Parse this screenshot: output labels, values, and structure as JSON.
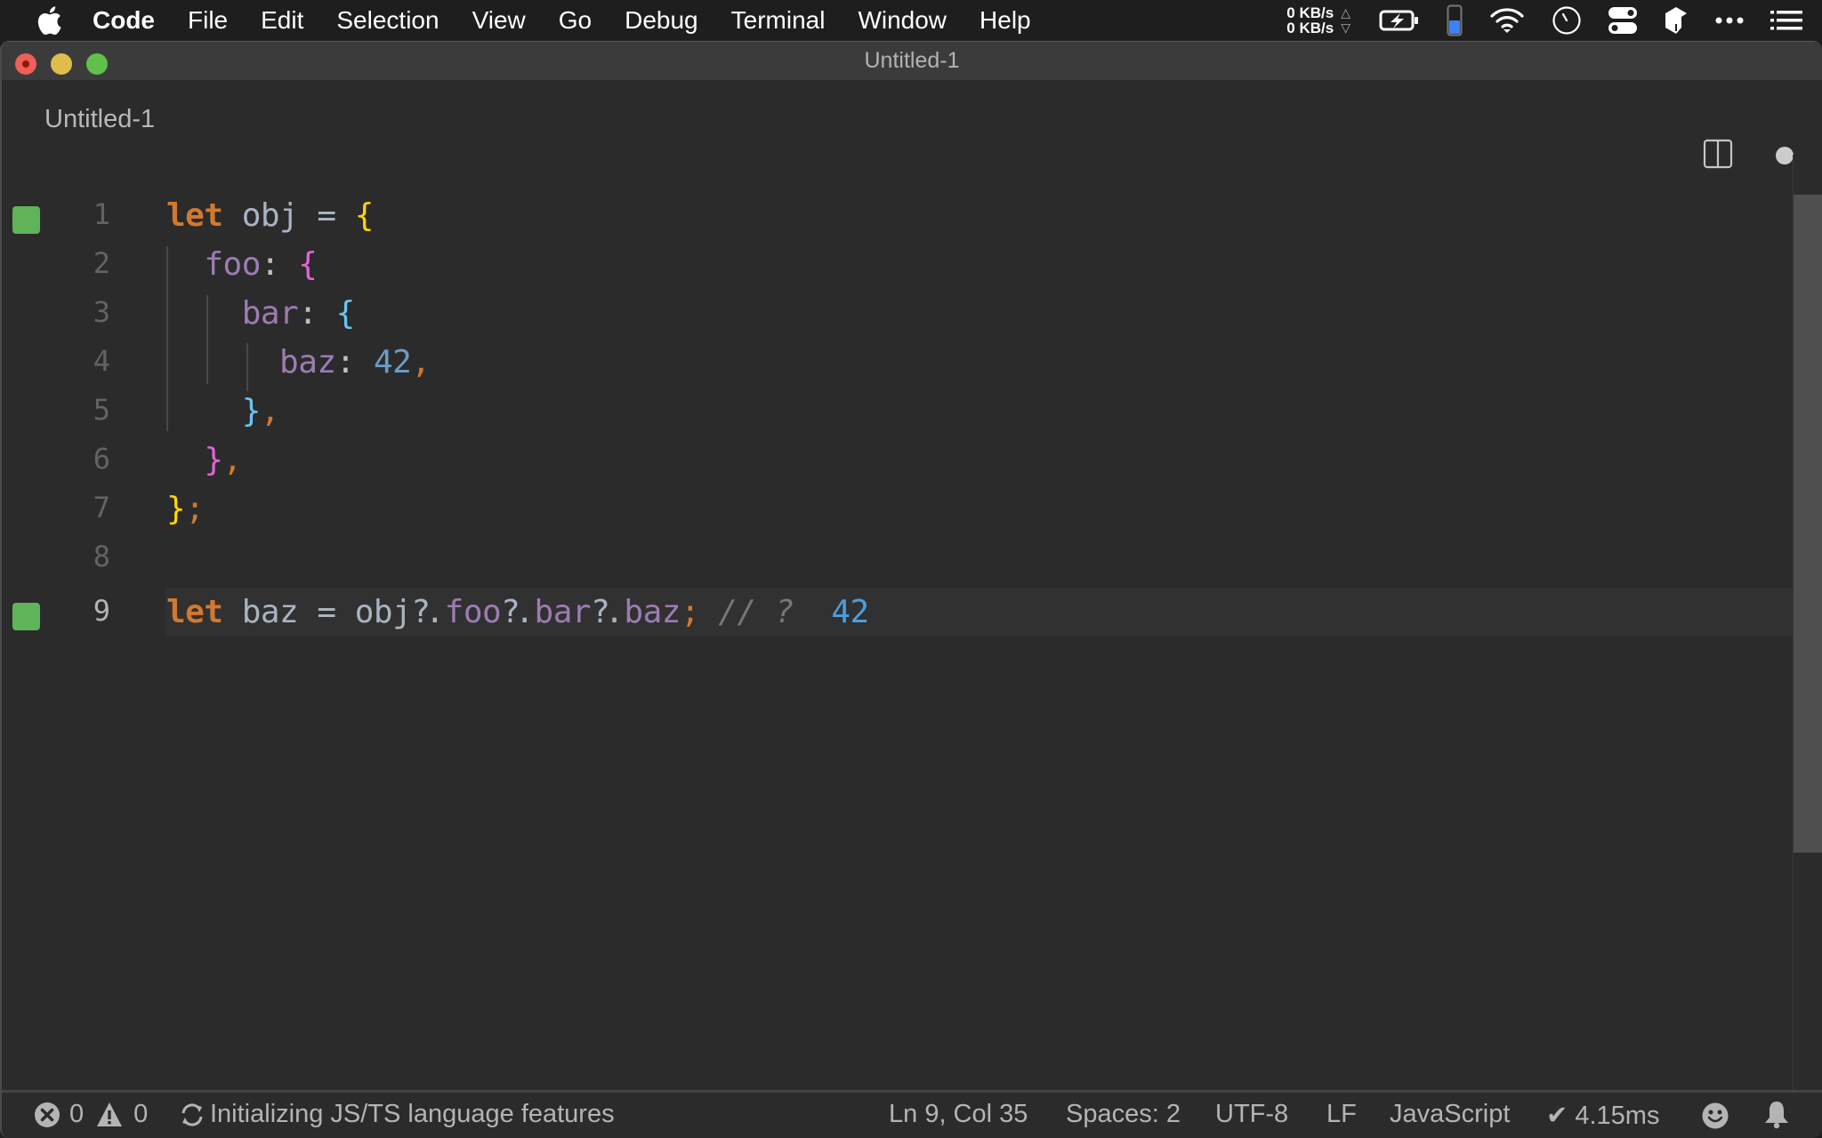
{
  "menubar": {
    "app_name": "Code",
    "items": [
      "File",
      "Edit",
      "Selection",
      "View",
      "Go",
      "Debug",
      "Terminal",
      "Window",
      "Help"
    ],
    "network": {
      "up": "0 KB/s",
      "down": "0 KB/s",
      "up_arrow": "△",
      "down_arrow": "▽"
    },
    "tray_icons": [
      "battery-charging-icon",
      "battery-level-icon",
      "wifi-icon",
      "clock-icon",
      "control-toggles-icon",
      "app-icon",
      "more-icon",
      "list-icon"
    ],
    "battery_level": 0.5
  },
  "window": {
    "title": "Untitled-1"
  },
  "tab": {
    "label": "Untitled-1",
    "dirty": true
  },
  "editor": {
    "language": "JavaScript",
    "current_line": 9,
    "lines": [
      {
        "number": "1",
        "marked": true
      },
      {
        "number": "2",
        "marked": false
      },
      {
        "number": "3",
        "marked": false
      },
      {
        "number": "4",
        "marked": false
      },
      {
        "number": "5",
        "marked": false
      },
      {
        "number": "6",
        "marked": false
      },
      {
        "number": "7",
        "marked": false
      },
      {
        "number": "8",
        "marked": false
      },
      {
        "number": "9",
        "marked": true
      }
    ],
    "tokens": {
      "l1": [
        "let",
        " obj = ",
        "{"
      ],
      "l2": [
        "foo",
        ":",
        " ",
        "{"
      ],
      "l3": [
        "bar",
        ":",
        " ",
        "{"
      ],
      "l4": [
        "baz",
        ":",
        " ",
        "42",
        ","
      ],
      "l5": [
        "}",
        ","
      ],
      "l6": [
        "}",
        ","
      ],
      "l7": [
        "}",
        ";"
      ],
      "l9": [
        "let",
        " baz = obj",
        "?.",
        "foo",
        "?.",
        "bar",
        "?.",
        "baz",
        ";",
        " // ?  ",
        "42"
      ]
    },
    "colors": {
      "keyword": "#d2792f",
      "property": "#9d7cb5",
      "number": "#6b9cc7",
      "bracket_level1": "#ffd600",
      "bracket_level2": "#e066d4",
      "bracket_level3": "#6cc4f6",
      "gutter_marker": "#5fb45a"
    }
  },
  "statusbar": {
    "errors": "0",
    "warnings": "0",
    "progress_text": "Initializing JS/TS language features",
    "cursor_position": "Ln 9, Col 35",
    "indentation": "Spaces: 2",
    "encoding": "UTF-8",
    "eol": "LF",
    "language_mode": "JavaScript",
    "timing": "✔ 4.15ms"
  }
}
